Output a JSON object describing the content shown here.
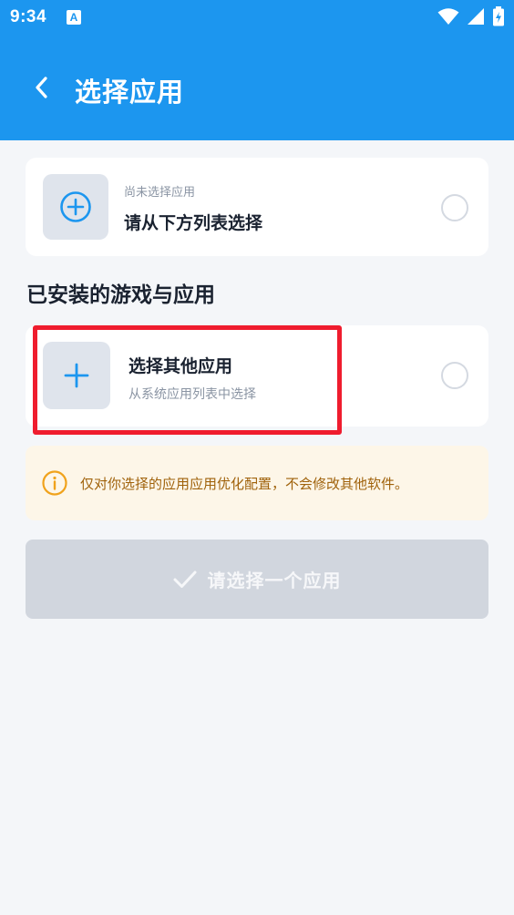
{
  "status_bar": {
    "time": "9:34",
    "notification_icon": "A"
  },
  "app_bar": {
    "title": "选择应用",
    "back_icon": "chevron-left-icon"
  },
  "current_selection": {
    "subtitle": "尚未选择应用",
    "title": "请从下方列表选择",
    "icon": "plus-circle-icon",
    "selected": false
  },
  "section": {
    "title": "已安装的游戏与应用"
  },
  "other_app": {
    "title": "选择其他应用",
    "subtitle": "从系统应用列表中选择",
    "icon": "plus-icon",
    "selected": false
  },
  "notice": {
    "text": "仅对你选择的应用应用优化配置，不会修改其他软件。",
    "icon": "info-icon"
  },
  "confirm": {
    "label": "请选择一个应用",
    "icon": "check-icon",
    "enabled": false
  },
  "colors": {
    "header": "#1c96ef",
    "accent": "#1c96ef",
    "highlight": "#ef1c2e",
    "notice_bg": "#fdf6e8",
    "notice_text": "#a0620b",
    "disabled_button": "#d1d6de"
  }
}
